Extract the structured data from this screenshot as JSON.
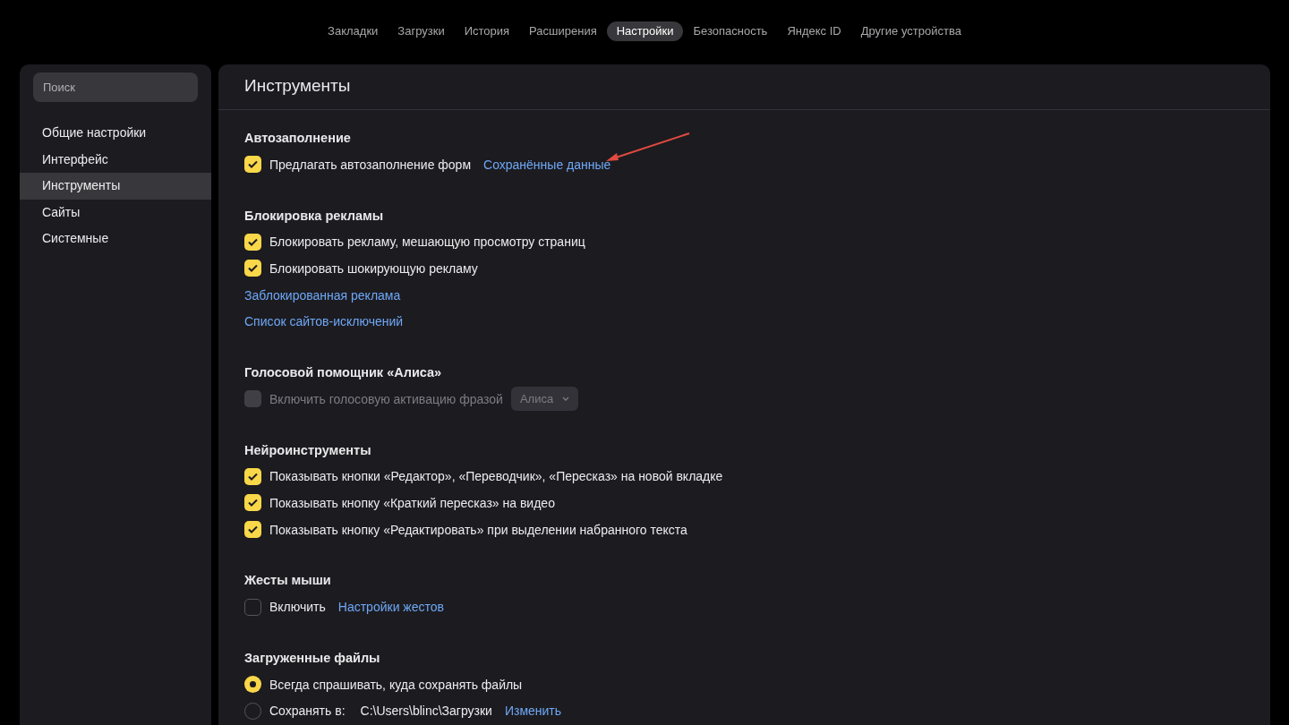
{
  "nav": {
    "tabs": [
      {
        "label": "Закладки",
        "selected": false
      },
      {
        "label": "Загрузки",
        "selected": false
      },
      {
        "label": "История",
        "selected": false
      },
      {
        "label": "Расширения",
        "selected": false
      },
      {
        "label": "Настройки",
        "selected": true
      },
      {
        "label": "Безопасность",
        "selected": false
      },
      {
        "label": "Яндекс ID",
        "selected": false
      },
      {
        "label": "Другие устройства",
        "selected": false
      }
    ]
  },
  "sidebar": {
    "search": {
      "placeholder": "Поиск"
    },
    "items": [
      {
        "label": "Общие настройки",
        "selected": false
      },
      {
        "label": "Интерфейс",
        "selected": false
      },
      {
        "label": "Инструменты",
        "selected": true
      },
      {
        "label": "Сайты",
        "selected": false
      },
      {
        "label": "Системные",
        "selected": false
      }
    ]
  },
  "main": {
    "title": "Инструменты",
    "sections": [
      {
        "title": "Автозаполнение",
        "rows": [
          {
            "kind": "checkbox",
            "label": "Предлагать автозаполнение форм",
            "checked": true,
            "disabled": false,
            "link": "Сохранённые данные"
          }
        ]
      },
      {
        "title": "Блокировка рекламы",
        "rows": [
          {
            "kind": "checkbox",
            "label": "Блокировать рекламу, мешающую просмотру страниц",
            "checked": true,
            "disabled": false
          },
          {
            "kind": "checkbox",
            "label": "Блокировать шокирующую рекламу",
            "checked": true,
            "disabled": false
          },
          {
            "kind": "link",
            "label": "Заблокированная реклама"
          },
          {
            "kind": "link",
            "label": "Список сайтов-исключений"
          }
        ]
      },
      {
        "title": "Голосовой помощник «Алиса»",
        "rows": [
          {
            "kind": "checkbox",
            "label": "Включить голосовую активацию фразой",
            "checked": false,
            "disabled": true,
            "dropdown": "Алиса"
          }
        ]
      },
      {
        "title": "Нейроинструменты",
        "rows": [
          {
            "kind": "checkbox",
            "label": "Показывать кнопки «Редактор», «Переводчик», «Пересказ» на новой вкладке",
            "checked": true,
            "disabled": false
          },
          {
            "kind": "checkbox",
            "label": "Показывать кнопку «Краткий пересказ» на видео",
            "checked": true,
            "disabled": false
          },
          {
            "kind": "checkbox",
            "label": "Показывать кнопку «Редактировать» при выделении набранного текста",
            "checked": true,
            "disabled": false
          }
        ]
      },
      {
        "title": "Жесты мыши",
        "rows": [
          {
            "kind": "checkbox",
            "label": "Включить",
            "checked": false,
            "disabled": false,
            "link": "Настройки жестов"
          }
        ]
      },
      {
        "title": "Загруженные файлы",
        "rows": [
          {
            "kind": "radio",
            "label": "Всегда спрашивать, куда сохранять файлы",
            "selected": true
          },
          {
            "kind": "radio",
            "label": "Сохранять в:",
            "selected": false,
            "path": "C:\\Users\\blinc\\Загрузки",
            "link": "Изменить"
          }
        ]
      }
    ]
  }
}
